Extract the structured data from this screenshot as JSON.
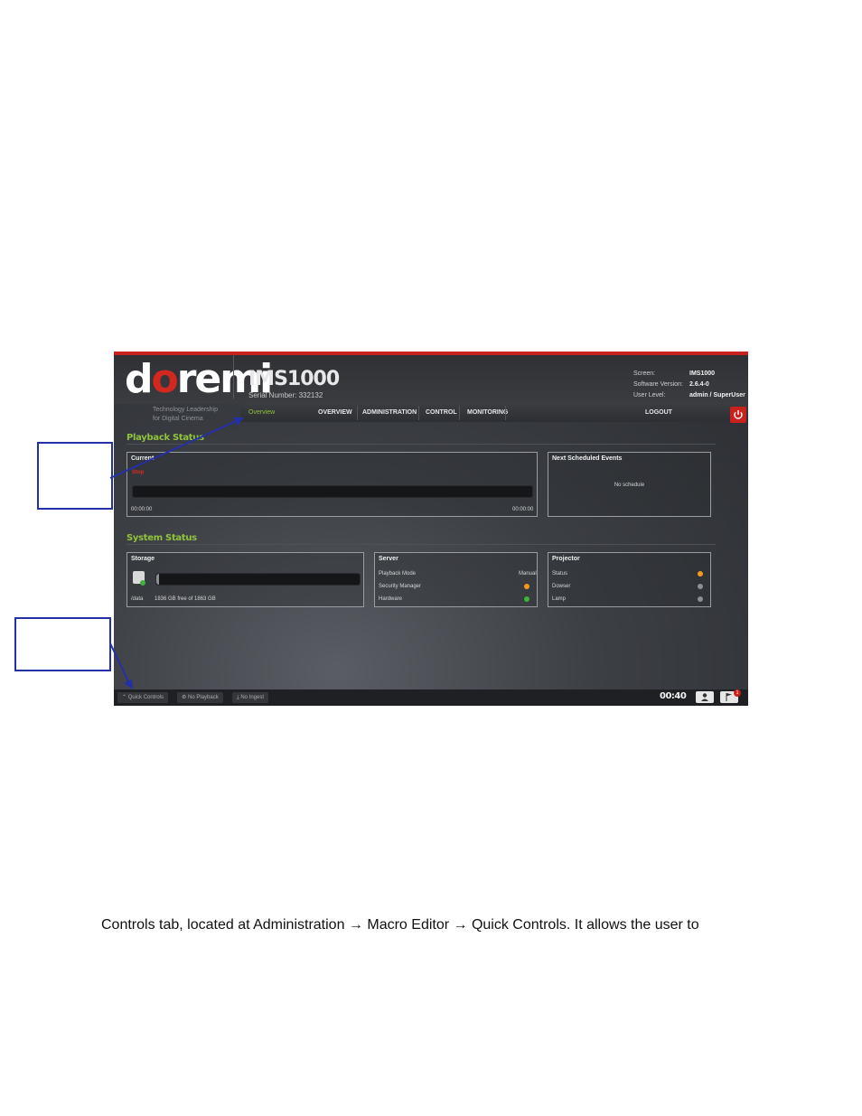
{
  "header": {
    "logo_left": "d",
    "logo_o": "o",
    "logo_right": "remi",
    "product": "IMS1000",
    "serial": "Serial Number: 332132",
    "tagline_line1": "Technology Leadership",
    "tagline_line2": "for Digital Cinema",
    "info": [
      {
        "label": "Screen:",
        "value": "IMS1000"
      },
      {
        "label": "Software Version:",
        "value": "2.6.4-0"
      },
      {
        "label": "User Level:",
        "value": "admin / SuperUser"
      }
    ]
  },
  "nav": {
    "overview_active": "Overview",
    "overview": "OVERVIEW",
    "administration": "ADMINISTRATION",
    "control": "CONTROL",
    "monitoring": "MONITORING",
    "logout": "LOGOUT"
  },
  "playback": {
    "title": "Playback Status",
    "current_title": "Current",
    "state": "Stop",
    "time_start": "00:00:00",
    "time_end": "00:00:00",
    "next_title": "Next Scheduled Events",
    "no_schedule": "No schedule"
  },
  "system": {
    "title": "System Status",
    "storage_title": "Storage",
    "storage_path": "/data",
    "storage_free": "1836 GB free of 1863 GB",
    "storage_used_fraction": 0.0145,
    "server_title": "Server",
    "playback_mode_label": "Playback Mode",
    "playback_mode_value": "Manual",
    "security_manager_label": "Security Manager",
    "hardware_label": "Hardware",
    "projector_title": "Projector",
    "status_label": "Status",
    "dowser_label": "Dowser",
    "lamp_label": "Lamp"
  },
  "colors": {
    "accent_green": "#8fc43c",
    "brand_red": "#c9211e",
    "status_orange": "#f39a1e",
    "status_green": "#3cb43c",
    "status_gray": "#8c8f93",
    "callout_blue": "#2430a8"
  },
  "footer": {
    "quick_controls": "Quick Controls",
    "no_playback": "No Playback",
    "no_ingest": "No Ingest",
    "clock": "00:40",
    "notifications": "1"
  },
  "caption": "Controls tab, located at Administration → Macro Editor → Quick Controls. It allows the user to"
}
